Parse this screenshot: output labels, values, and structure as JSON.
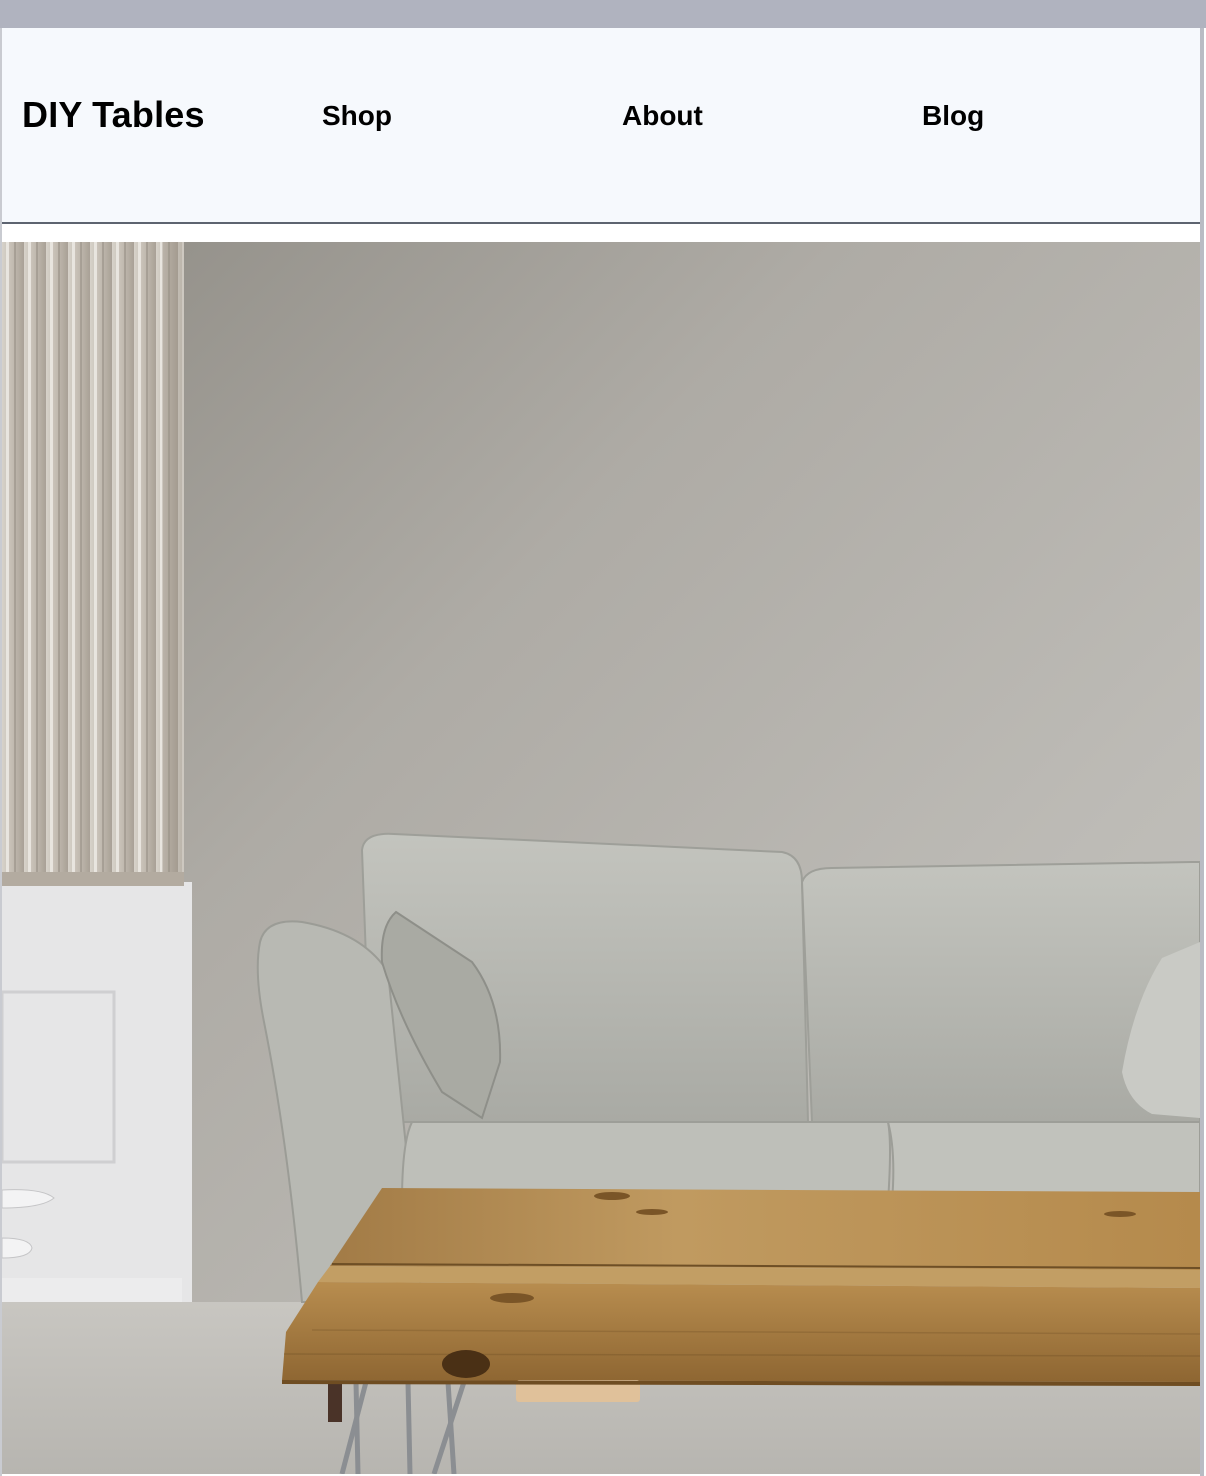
{
  "header": {
    "brand": "DIY Tables",
    "nav": [
      {
        "label": "Shop"
      },
      {
        "label": "About"
      },
      {
        "label": "Blog"
      }
    ]
  },
  "colors": {
    "header_bg": "#f6f9fd",
    "top_strip": "#b0b3bf",
    "wall": "#b7b4ae",
    "sofa": "#b9bab4",
    "table_wood": "#b48a4c"
  },
  "hero": {
    "icon": "living-room-photo"
  }
}
